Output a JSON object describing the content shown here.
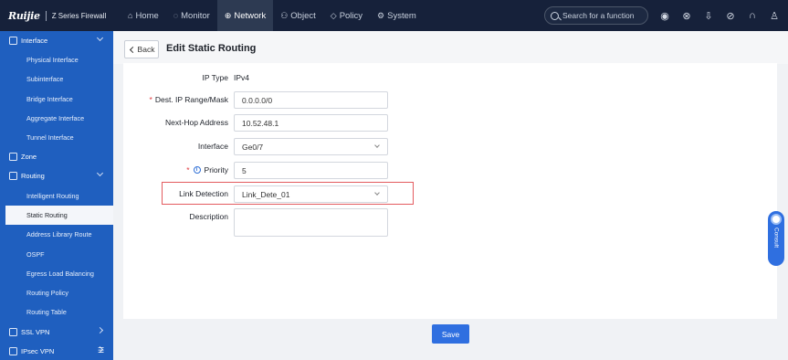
{
  "brand": {
    "logo": "Ruijie",
    "product": "Z Series Firewall"
  },
  "nav": [
    {
      "icon": "⌂",
      "label": "Home"
    },
    {
      "icon": "◌",
      "label": "Monitor"
    },
    {
      "icon": "⊕",
      "label": "Network"
    },
    {
      "icon": "⚇",
      "label": "Object"
    },
    {
      "icon": "◇",
      "label": "Policy"
    },
    {
      "icon": "⚙",
      "label": "System"
    }
  ],
  "search": {
    "placeholder": "Search for a function"
  },
  "toolbar_icons": [
    "broadcast-icon",
    "network-icon",
    "download-icon",
    "compass-icon",
    "headset-icon",
    "user-icon"
  ],
  "sidebar": {
    "groups": [
      {
        "label": "Interface",
        "items": [
          "Physical Interface",
          "Subinterface",
          "Bridge Interface",
          "Aggregate Interface",
          "Tunnel Interface"
        ]
      },
      {
        "label": "Zone"
      },
      {
        "label": "Routing",
        "items": [
          "Intelligent Routing",
          "Static Routing",
          "Address Library Route",
          "OSPF",
          "Egress Load Balancing",
          "Routing Policy",
          "Routing Table"
        ]
      },
      {
        "label": "SSL VPN"
      },
      {
        "label": "IPsec VPN"
      }
    ],
    "active_item": "Static Routing"
  },
  "header": {
    "back_label": "Back",
    "title": "Edit Static Routing"
  },
  "form": {
    "ip_type": {
      "label": "IP Type",
      "value": "IPv4"
    },
    "dest": {
      "label": "Dest. IP Range/Mask",
      "value": "0.0.0.0/0"
    },
    "nexthop": {
      "label": "Next-Hop Address",
      "value": "10.52.48.1"
    },
    "interface": {
      "label": "Interface",
      "value": "Ge0/7"
    },
    "priority": {
      "label": "Priority",
      "value": "5"
    },
    "link_detection": {
      "label": "Link Detection",
      "value": "Link_Dete_01"
    },
    "description": {
      "label": "Description",
      "value": ""
    }
  },
  "save_label": "Save",
  "consult_label": "Consult",
  "colors": {
    "topbar": "#16213a",
    "sidebar": "#1f5fbf",
    "primary": "#2f6fe0",
    "highlight": "#e35b5f"
  }
}
